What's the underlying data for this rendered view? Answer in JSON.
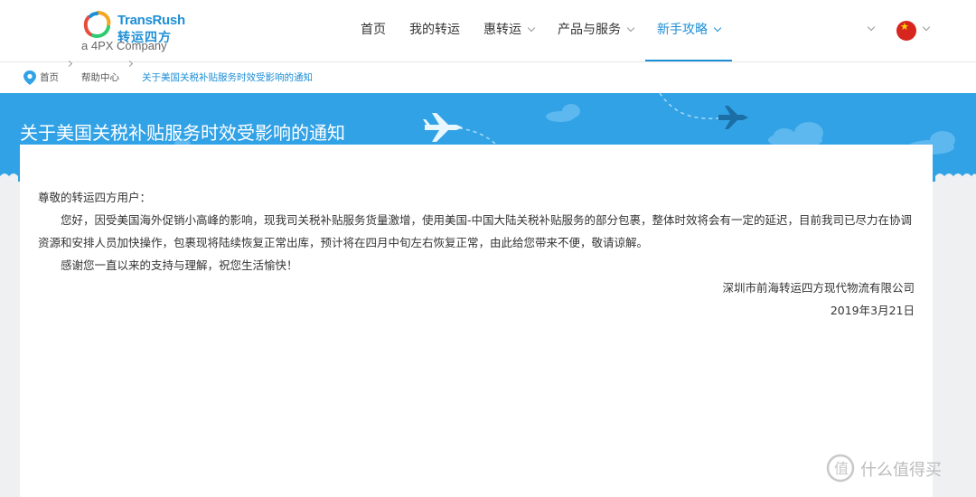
{
  "brand": {
    "name_en": "TransRush",
    "name_cn": "转运四方",
    "tagline": "a 4PX Company"
  },
  "nav": [
    {
      "label": "首页",
      "has_menu": false
    },
    {
      "label": "我的转运",
      "has_menu": false
    },
    {
      "label": "惠转运",
      "has_menu": true
    },
    {
      "label": "产品与服务",
      "has_menu": true
    },
    {
      "label": "新手攻略",
      "has_menu": true,
      "active": true
    }
  ],
  "breadcrumb": [
    "首页",
    "帮助中心",
    "关于美国关税补贴服务时效受影响的通知"
  ],
  "page_title": "关于美国关税补贴服务时效受影响的通知",
  "letter": {
    "salutation": "尊敬的转运四方用户：",
    "body": "您好，因受美国海外促销小高峰的影响，现我司关税补贴服务货量激增，使用美国-中国大陆关税补贴服务的部分包裹，整体时效将会有一定的延迟，目前我司已尽力在协调资源和安排人员加快操作，包裹现将陆续恢复正常出库，预计将在四月中旬左右恢复正常，由此给您带来不便，敬请谅解。",
    "closing": "感谢您一直以来的支持与理解，祝您生活愉快！",
    "signature": "深圳市前海转运四方现代物流有限公司",
    "date": "2019年3月21日"
  },
  "watermark": "什么值得买",
  "colors": {
    "accent": "#1e8fd6",
    "banner": "#31a2e6",
    "flag": "#d7261e"
  },
  "icons": [
    "location-pin-icon",
    "airplane-icon",
    "cloud-icon",
    "flag-cn-icon",
    "chevron-down-icon"
  ]
}
